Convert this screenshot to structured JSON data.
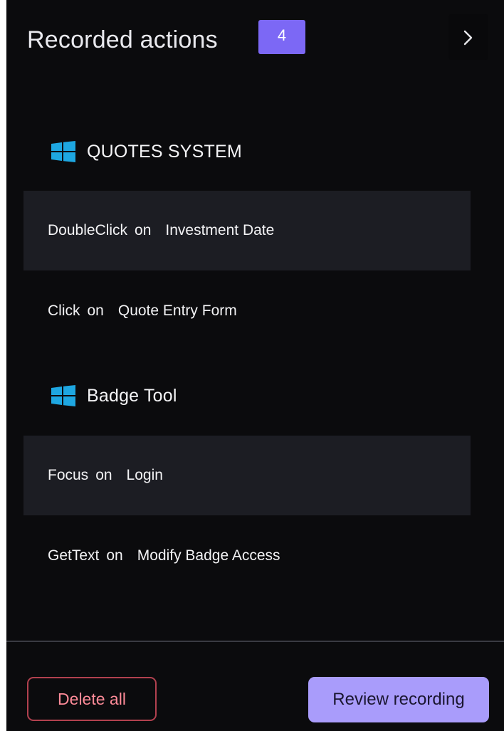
{
  "header": {
    "title": "Recorded actions",
    "count": "4",
    "expand_icon": "chevron-right-icon"
  },
  "groups": [
    {
      "label": "QUOTES SYSTEM",
      "icon": "windows-icon",
      "actions": [
        {
          "verb": "DoubleClick",
          "connector": "on",
          "target": "Investment Date",
          "selected": true
        },
        {
          "verb": "Click",
          "connector": "on",
          "target": "Quote Entry Form",
          "selected": false
        }
      ]
    },
    {
      "label": "Badge Tool",
      "icon": "windows-icon",
      "actions": [
        {
          "verb": "Focus",
          "connector": "on",
          "target": "Login",
          "selected": true
        },
        {
          "verb": "GetText",
          "connector": "on",
          "target": "Modify Badge Access",
          "selected": false
        }
      ]
    }
  ],
  "footer": {
    "delete_label": "Delete all",
    "review_label": "Review recording"
  },
  "colors": {
    "background": "#0b0b0d",
    "row_selected": "#1c1d23",
    "badge": "#7c68f5",
    "primary_button": "#a99cfb",
    "danger": "#b2414f",
    "windows_icon": "#1ea7e1"
  }
}
